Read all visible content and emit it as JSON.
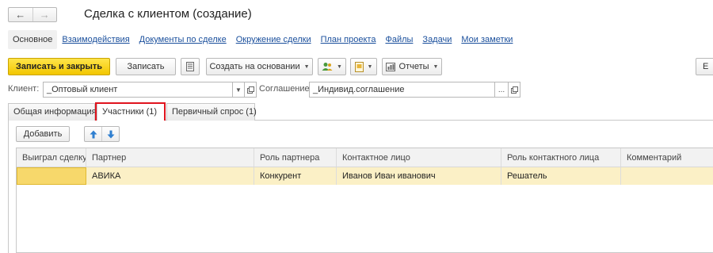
{
  "window": {
    "title": "Сделка с клиентом (создание)"
  },
  "nav": {
    "back_icon": "←",
    "forward_icon": "→"
  },
  "sections": [
    {
      "label": "Основное"
    },
    {
      "label": "Взаимодействия"
    },
    {
      "label": "Документы по сделке"
    },
    {
      "label": "Окружение сделки"
    },
    {
      "label": "План проекта"
    },
    {
      "label": "Файлы"
    },
    {
      "label": "Задачи"
    },
    {
      "label": "Мои заметки"
    }
  ],
  "toolbar": {
    "save_close_label": "Записать и закрыть",
    "save_label": "Записать",
    "create_based_label": "Создать на основании",
    "reports_label": "Отчеты",
    "edge_label": "Е"
  },
  "fields": {
    "client_label": "Клиент:",
    "client_value": "_Оптовый клиент",
    "agreement_label": "Соглашение:",
    "agreement_value": "_Индивид.соглашение",
    "ellipsis": "..."
  },
  "tabs": [
    {
      "label": "Общая информация"
    },
    {
      "label": "Участники (1)"
    },
    {
      "label": "Первичный спрос (1)"
    }
  ],
  "participants": {
    "add_label": "Добавить",
    "columns": [
      "Выиграл сделку",
      "Партнер",
      "Роль партнера",
      "Контактное лицо",
      "Роль контактного лица",
      "Комментарий"
    ],
    "rows": [
      [
        "",
        "АВИКА",
        "Конкурент",
        "Иванов Иван иванович",
        "Решатель",
        ""
      ]
    ]
  },
  "colors": {
    "primary_button": "#f2c600",
    "highlight_frame": "#e0141e",
    "selected_row": "#fbf0c6",
    "link": "#1a4f9c"
  }
}
